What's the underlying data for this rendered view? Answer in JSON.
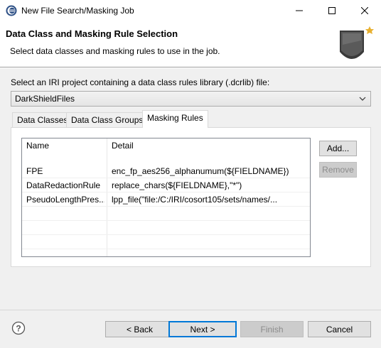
{
  "window": {
    "title": "New File Search/Masking Job",
    "minimize_glyph": "—",
    "maximize_glyph": "☐",
    "close_glyph": "✕"
  },
  "header": {
    "title": "Data Class and Masking Rule Selection",
    "description": "Select data classes and masking rules to use in the job."
  },
  "project": {
    "label": "Select an IRI project containing a data class rules library (.dcrlib) file:",
    "selected": "DarkShieldFiles"
  },
  "tabs": [
    {
      "label": "Data Classes",
      "active": false
    },
    {
      "label": "Data Class Groups",
      "active": false
    },
    {
      "label": "Masking Rules",
      "active": true
    }
  ],
  "table": {
    "columns": [
      "Name",
      "Detail"
    ],
    "rows": [
      {
        "name": "FPE",
        "detail": "enc_fp_aes256_alphanumum(${FIELDNAME})"
      },
      {
        "name": "DataRedactionRule",
        "detail": "replace_chars(${FIELDNAME},\"*\")"
      },
      {
        "name": "PseudoLengthPres...",
        "detail": "lpp_file(\"file:/C:/IRI/cosort105/sets/names/..."
      }
    ]
  },
  "side_buttons": {
    "add": "Add...",
    "remove": "Remove"
  },
  "footer": {
    "back": "< Back",
    "next": "Next >",
    "finish": "Finish",
    "cancel": "Cancel"
  },
  "icons": {
    "app": "eclipse-app-icon",
    "wizard": "wizard-banner-icon",
    "help": "help-icon",
    "dropdown": "chevron-down-icon"
  },
  "colors": {
    "focus_blue": "#0078d7",
    "dialog_bg": "#f0f0f0"
  }
}
